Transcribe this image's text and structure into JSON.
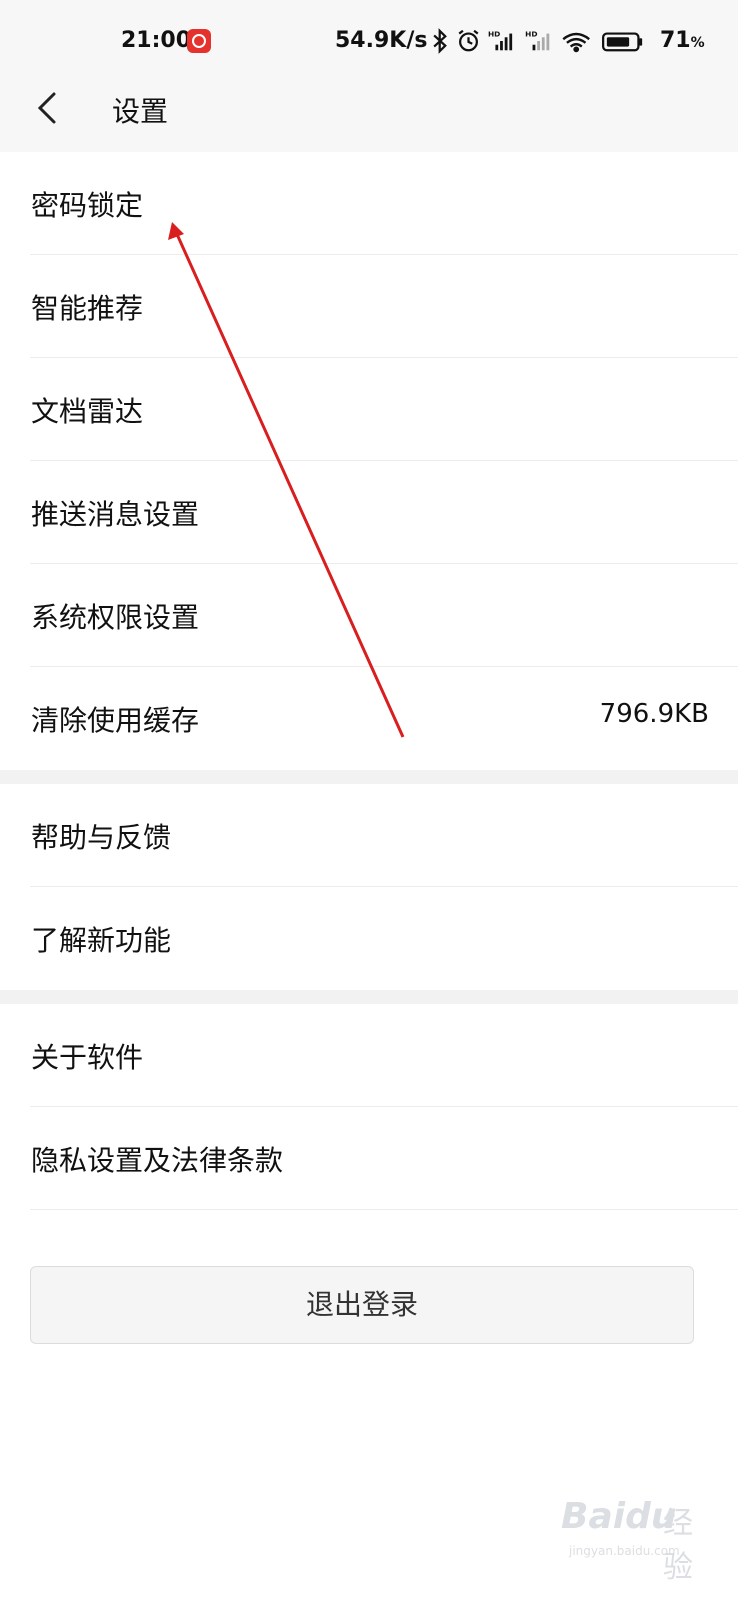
{
  "status_bar": {
    "time": "21:00",
    "net_speed": "54.9K/s",
    "battery": "71",
    "battery_unit": "%",
    "icons": [
      "notification-app-icon",
      "bluetooth-icon",
      "alarm-icon",
      "hd-signal-icon",
      "hd-signal-icon",
      "wifi-icon",
      "battery-icon"
    ]
  },
  "header": {
    "title": "设置"
  },
  "section1": [
    {
      "label": "密码锁定",
      "value": ""
    },
    {
      "label": "智能推荐",
      "value": ""
    },
    {
      "label": "文档雷达",
      "value": ""
    },
    {
      "label": "推送消息设置",
      "value": ""
    },
    {
      "label": "系统权限设置",
      "value": ""
    },
    {
      "label": "清除使用缓存",
      "value": "796.9KB"
    }
  ],
  "section2": [
    {
      "label": "帮助与反馈"
    },
    {
      "label": "了解新功能"
    }
  ],
  "section3": [
    {
      "label": "关于软件"
    },
    {
      "label": "隐私设置及法律条款"
    }
  ],
  "logout_label": "退出登录",
  "annotation": {
    "color": "#d81e1e"
  },
  "watermark": {
    "brand": "Baidu",
    "brand_cn": "经验",
    "url": "jingyan.baidu.com"
  }
}
